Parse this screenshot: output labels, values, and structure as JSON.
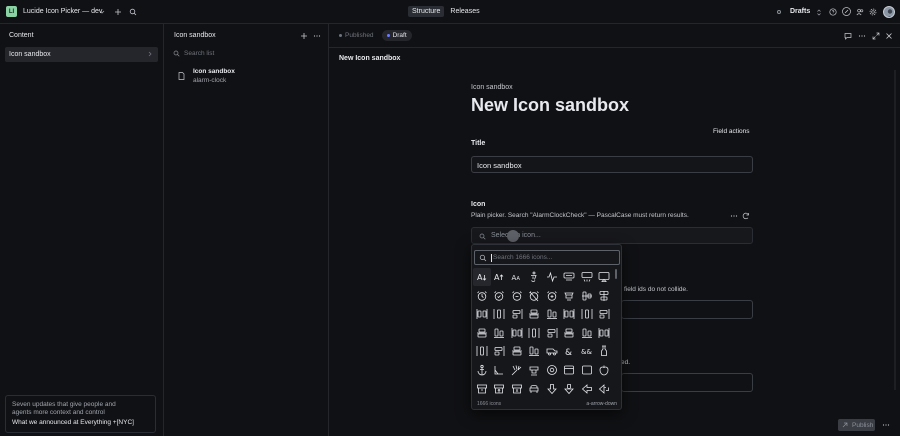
{
  "app": {
    "logo_letter": "LI",
    "workspace_title": "Lucide Icon Picker — dev"
  },
  "topnav": {
    "tabs": [
      {
        "label": "Structure",
        "active": true
      },
      {
        "label": "Releases",
        "active": false
      }
    ],
    "drafts_label": "Drafts"
  },
  "content_pane": {
    "title": "Content",
    "items": [
      {
        "label": "Icon sandbox"
      }
    ],
    "announcement": {
      "line1": "Seven updates that give people and",
      "line2": "agents more context and control",
      "link": "What we announced at Everything +[NYC]"
    }
  },
  "list_pane": {
    "title": "Icon sandbox",
    "search_placeholder": "Search list",
    "documents": [
      {
        "title": "Icon sandbox",
        "subtitle": "alarm-clock"
      }
    ]
  },
  "editor": {
    "tab_published": "Published",
    "tab_draft": "Draft",
    "doc_title": "New Icon sandbox",
    "breadcrumb": "Icon sandbox",
    "heading": "New Icon sandbox",
    "field_actions": "Field actions",
    "title_label": "Title",
    "title_value": "Icon sandbox",
    "icon_label": "Icon",
    "icon_description": "Plain picker. Search \"AlarmClockCheck\" — PascalCase must return results.",
    "icon_picker_placeholder": "Select an icon...",
    "hidden_text_1": "field ids do not collide.",
    "hidden_text_2": "ed.",
    "publish_label": "Publish",
    "colors": {
      "draft_dot": "#6b7cff",
      "published_dot": "#6f737c"
    }
  },
  "icon_popover": {
    "search_placeholder": "Search 1666 icons...",
    "count_label": "1666 icons",
    "hint_label": "a-arrow-down",
    "icons": [
      "a-arrow-down-icon",
      "a-arrow-up-icon",
      "a-large-small-icon",
      "accessibility-icon",
      "activity-icon",
      "air-vent-icon",
      "airplay-icon",
      "alarm-clock-icon",
      "alarm-clock-check-icon",
      "alarm-clock-minus-icon",
      "alarm-clock-off-icon",
      "alarm-clock-plus-icon",
      "alarm-smoke-icon",
      "album-icon",
      "align-center-horizontal-icon",
      "align-center-vertical-icon",
      "align-end-horizontal-icon",
      "align-end-vertical-icon",
      "align-horizontal-distribute-center-icon",
      "align-horizontal-distribute-end-icon",
      "align-horizontal-distribute-start-icon",
      "align-horizontal-justify-center-icon",
      "align-horizontal-justify-end-icon",
      "align-horizontal-justify-start-icon",
      "align-horizontal-space-around-icon",
      "align-horizontal-space-between-icon",
      "align-start-horizontal-icon",
      "align-start-vertical-icon",
      "align-vertical-distribute-center-icon",
      "align-vertical-distribute-end-icon",
      "align-vertical-distribute-start-icon",
      "align-vertical-justify-center-icon",
      "align-vertical-justify-end-icon",
      "align-vertical-justify-start-icon",
      "align-vertical-space-around-icon",
      "align-vertical-space-between-icon",
      "ambulance-icon",
      "ampersand-icon",
      "ampersands-icon",
      "amphora-icon",
      "anchor-icon",
      "angry-icon",
      "annoyed-icon",
      "antenna-icon",
      "anvil-icon",
      "aperture-icon",
      "app-window-icon",
      "app-window-mac-icon",
      "apple-icon",
      "archive-icon",
      "archive-restore-icon",
      "archive-x-icon",
      "armchair-icon",
      "arrow-big-down-icon",
      "arrow-big-down-dash-icon",
      "arrow-big-left-icon"
    ]
  }
}
